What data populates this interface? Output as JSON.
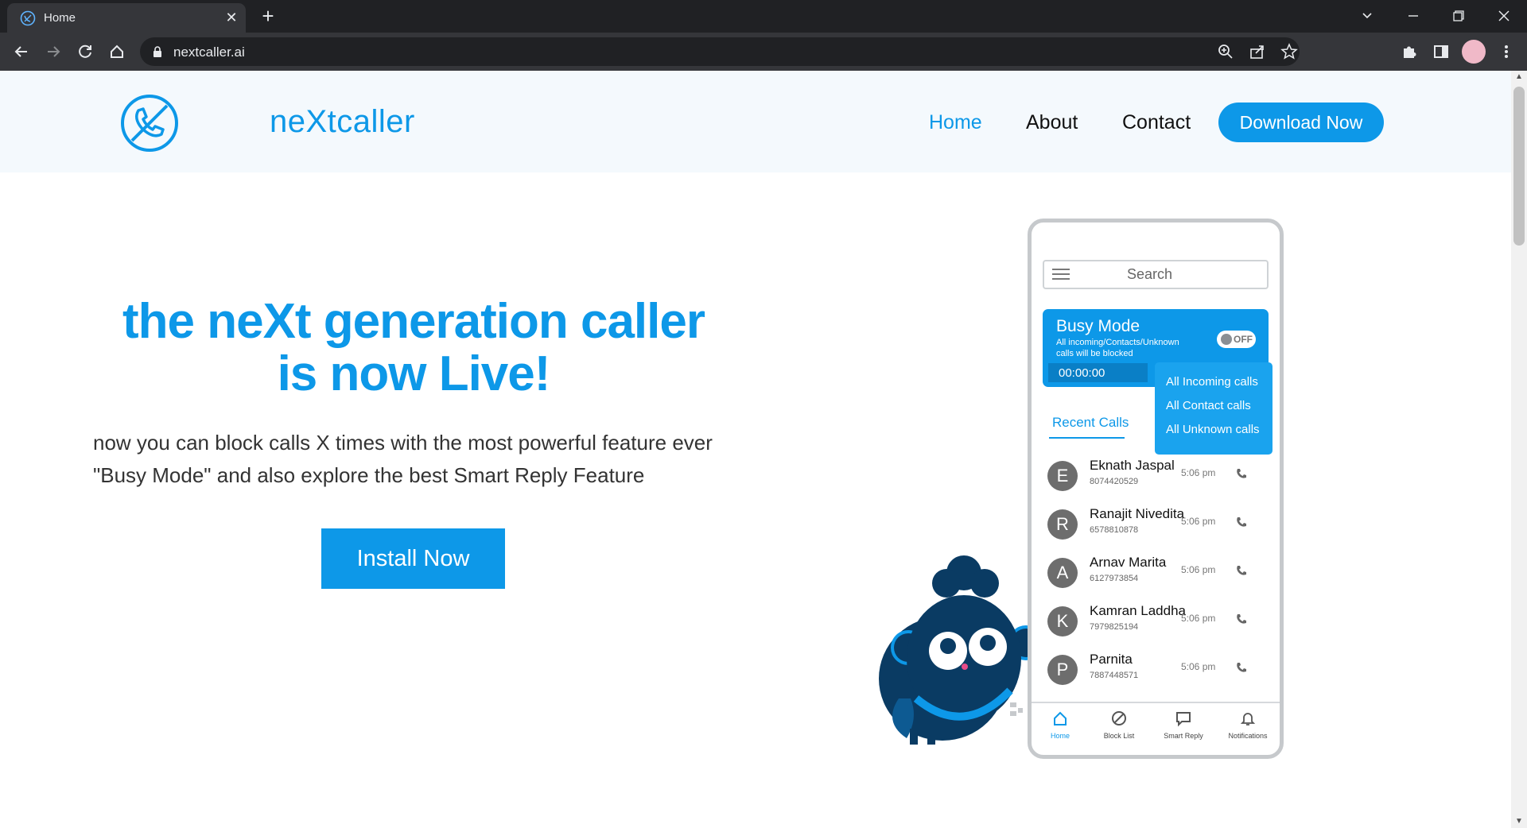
{
  "browser": {
    "tab_title": "Home",
    "url": "nextcaller.ai"
  },
  "header": {
    "brand": "neXtcaller",
    "nav": [
      "Home",
      "About",
      "Contact"
    ],
    "download_label": "Download Now"
  },
  "hero": {
    "headline_line1": "the neXt generation caller",
    "headline_line2": "is now Live!",
    "sub_line1": "now you can block calls X times with the most powerful feature ever",
    "sub_line2": "\"Busy Mode\" and also explore the best Smart Reply Feature",
    "install_label": "Install Now"
  },
  "phone": {
    "search_placeholder": "Search",
    "busy_title": "Busy Mode",
    "busy_desc": "All incoming/Contacts/Unknown calls will be blocked",
    "toggle_label": "OFF",
    "timer": "00:00:00",
    "dropdown": [
      "All Incoming calls",
      "All Contact calls",
      "All Unknown calls"
    ],
    "recent_label": "Recent Calls",
    "calls": [
      {
        "initial": "E",
        "name": "Eknath Jaspal",
        "number": "8074420529",
        "time": "5:06 pm"
      },
      {
        "initial": "R",
        "name": "Ranajit Nivedita",
        "number": "6578810878",
        "time": "5:06 pm"
      },
      {
        "initial": "A",
        "name": "Arnav Marita",
        "number": "6127973854",
        "time": "5:06 pm"
      },
      {
        "initial": "K",
        "name": "Kamran Laddha",
        "number": "7979825194",
        "time": "5:06 pm"
      },
      {
        "initial": "P",
        "name": "Parnita",
        "number": "7887448571",
        "time": "5:06 pm"
      }
    ],
    "bottom_nav": [
      "Home",
      "Block List",
      "Smart Reply",
      "Notifications"
    ]
  },
  "colors": {
    "accent": "#0d98e8",
    "mascot": "#0a3b63"
  }
}
